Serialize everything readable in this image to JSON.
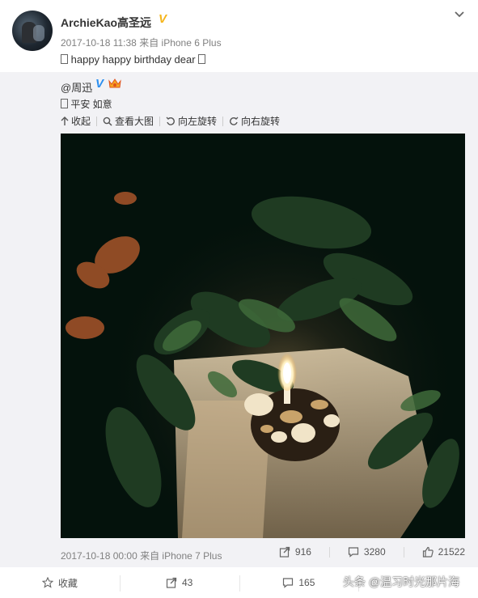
{
  "post": {
    "author": "ArchieKao高圣远",
    "timestamp": "2017-10-18 11:38",
    "source": "来自 iPhone 6 Plus",
    "text": "happy happy birthday dear"
  },
  "repost": {
    "author": "@周迅",
    "text": "平安 如意",
    "tools": {
      "collapse": "收起",
      "view_large": "查看大图",
      "rotate_left": "向左旋转",
      "rotate_right": "向右旋转"
    },
    "timestamp": "2017-10-18 00:00",
    "source": "来自 iPhone 7 Plus",
    "stats": {
      "reposts": "916",
      "comments": "3280",
      "likes": "21522"
    }
  },
  "actions": {
    "favorite": "收藏",
    "repost_count": "43",
    "comment_count": "165"
  },
  "watermark": "头条 @温习时光那片海",
  "colors": {
    "verified_yellow": "#f5b51b",
    "verified_blue": "#2c8ff0",
    "repost_bg": "#f2f2f5"
  }
}
